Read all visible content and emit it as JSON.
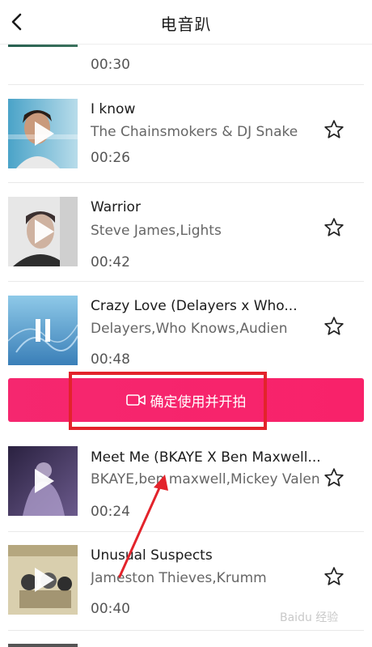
{
  "header": {
    "title": "电音趴"
  },
  "songs": [
    {
      "title": "",
      "artist": "",
      "duration": "00:30",
      "favorited": false,
      "state": "idle"
    },
    {
      "title": "I know",
      "artist": "The Chainsmokers & DJ Snake",
      "duration": "00:26",
      "favorited": false,
      "state": "idle"
    },
    {
      "title": "Warrior",
      "artist": "Steve James,Lights",
      "duration": "00:42",
      "favorited": false,
      "state": "idle"
    },
    {
      "title": "Crazy Love (Delayers x Who...",
      "artist": "Delayers,Who Knows,Audien",
      "duration": "00:48",
      "favorited": false,
      "state": "playing"
    },
    {
      "title": "Meet Me (BKAYE X Ben Maxwell...",
      "artist": "BKAYE,ben maxwell,Mickey Valen",
      "duration": "00:24",
      "favorited": false,
      "state": "idle"
    },
    {
      "title": "Unusual Suspects",
      "artist": "Jameston Thieves,Krumm",
      "duration": "00:40",
      "favorited": false,
      "state": "idle"
    }
  ],
  "action": {
    "confirm_label": "确定使用并开拍"
  },
  "colors": {
    "accent": "#f5276f",
    "annotation": "#e3232b"
  },
  "watermark": "Baidu 经验"
}
